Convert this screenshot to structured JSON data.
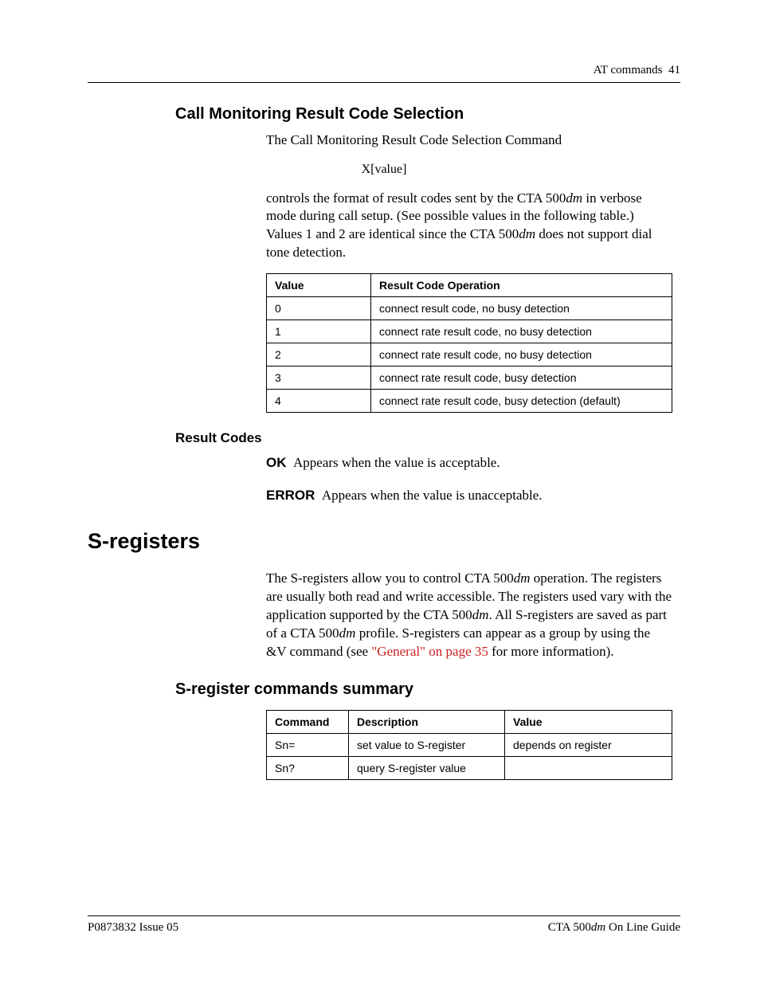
{
  "header": {
    "section": "AT commands",
    "page_num": "41"
  },
  "cmrc": {
    "heading": "Call Monitoring Result Code Selection",
    "intro": "The Call Monitoring Result Code Selection Command",
    "syntax": "X[value]",
    "para_a": "controls the format of result codes sent by the CTA 500",
    "para_b": " in verbose mode during call setup. (See possible values in the following table.) Values 1 and 2 are identical since the CTA 500",
    "para_c": " does not support dial tone detection.",
    "dm": "dm",
    "table": {
      "head": {
        "c1": "Value",
        "c2": "Result Code Operation"
      },
      "rows": [
        {
          "c1": "0",
          "c2": "connect result code, no busy detection"
        },
        {
          "c1": "1",
          "c2": "connect rate result code, no busy detection"
        },
        {
          "c1": "2",
          "c2": "connect rate result code, no busy detection"
        },
        {
          "c1": "3",
          "c2": "connect rate result code, busy detection"
        },
        {
          "c1": "4",
          "c2": "connect rate result code, busy detection (default)"
        }
      ]
    }
  },
  "result_codes": {
    "heading": "Result Codes",
    "ok_label": "OK",
    "ok_text": "Appears when the value is acceptable.",
    "err_label": "ERROR",
    "err_text": "Appears when the value is unacceptable."
  },
  "sreg": {
    "heading": "S-registers",
    "p_a": "The S-registers allow you to control CTA 500",
    "p_b": " operation. The registers are usually both read and write accessible. The registers used vary with the application supported by the CTA 500",
    "p_c": ". All S-registers are saved as part of a CTA 500",
    "p_d": " profile. S-registers can appear as a group by using the &V command (see ",
    "link": "\"General\" on page 35",
    "p_e": " for more information).",
    "dm": "dm",
    "sub_heading": "S-register commands summary",
    "table": {
      "head": {
        "c1": "Command",
        "c2": "Description",
        "c3": "Value"
      },
      "rows": [
        {
          "c1": "Sn=",
          "c2": "set value to S-register",
          "c3": "depends on register"
        },
        {
          "c1": "Sn?",
          "c2": "query S-register value",
          "c3": ""
        }
      ]
    }
  },
  "footer": {
    "left": "P0873832  Issue 05",
    "right_a": "CTA 500",
    "right_dm": "dm",
    "right_b": " On Line Guide"
  }
}
